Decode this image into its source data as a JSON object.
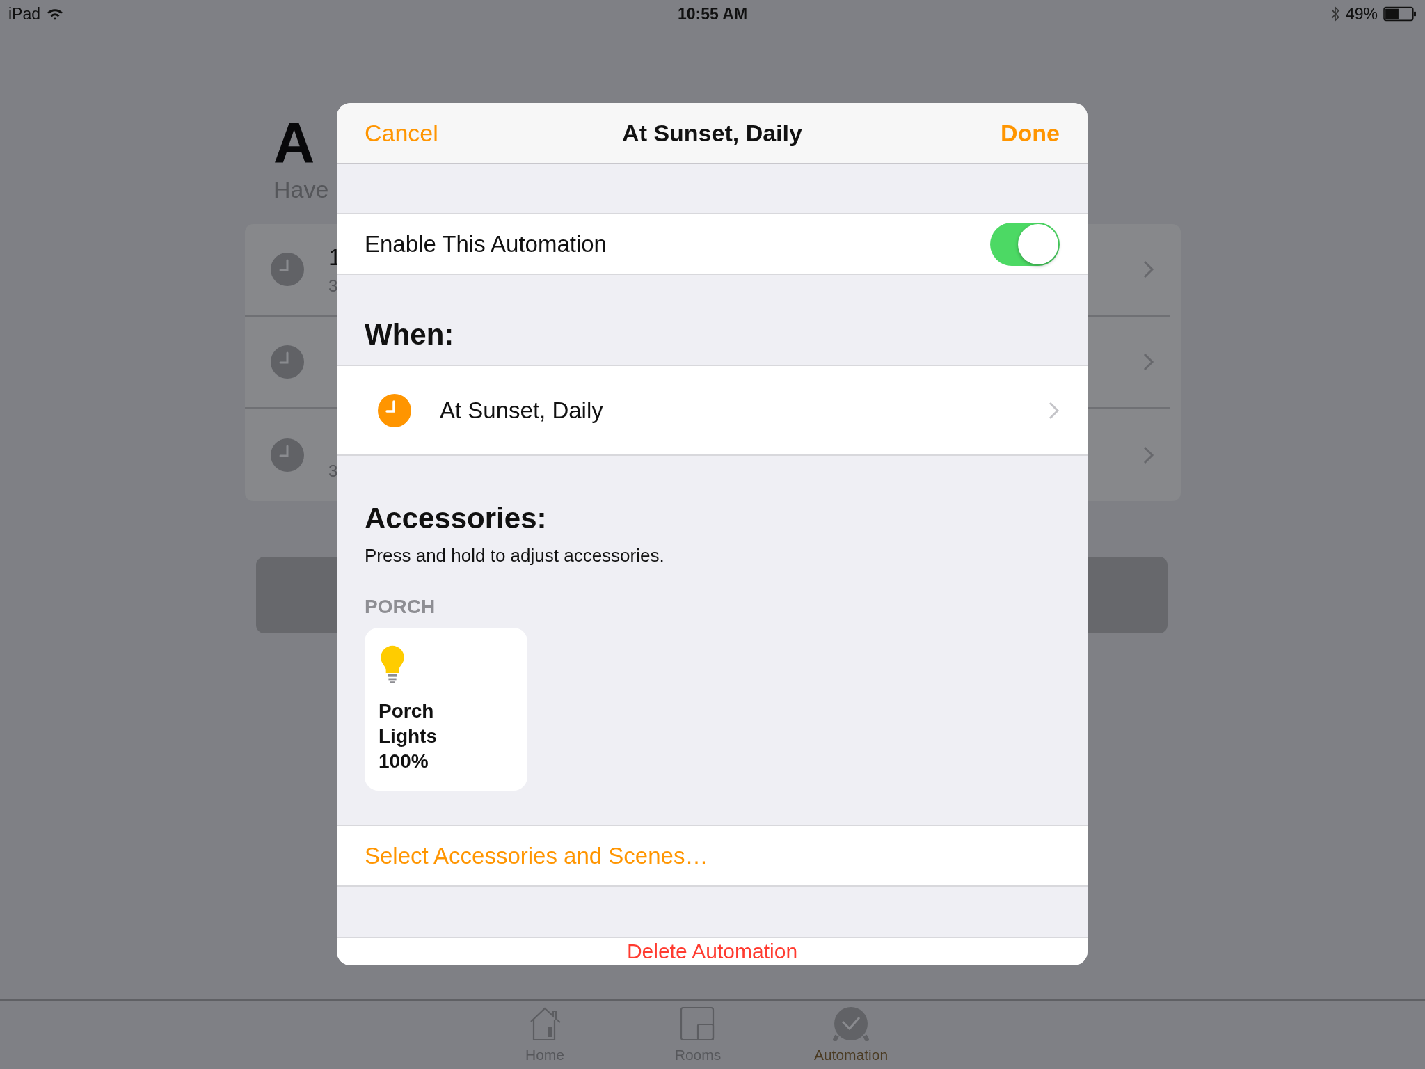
{
  "status_bar": {
    "device": "iPad",
    "time": "10:55 AM",
    "battery": "49%"
  },
  "background": {
    "title": "A",
    "subtitle": "Have",
    "rows": [
      {
        "title": "1",
        "subtitle": "3"
      },
      {},
      {
        "subtitle": "3"
      }
    ]
  },
  "modal": {
    "cancel": "Cancel",
    "title": "At Sunset, Daily",
    "done": "Done",
    "enable": {
      "label": "Enable This Automation",
      "on": true
    },
    "when_heading": "When:",
    "trigger": "At Sunset, Daily",
    "accessories_heading": "Accessories:",
    "accessories_hint": "Press and hold to adjust accessories.",
    "room": "PORCH",
    "accessories": [
      {
        "name": "Porch Lights",
        "value": "100%"
      }
    ],
    "select_link": "Select Accessories and Scenes…",
    "delete": "Delete Automation"
  },
  "tab_bar": [
    {
      "label": "Home",
      "selected": false
    },
    {
      "label": "Rooms",
      "selected": false
    },
    {
      "label": "Automation",
      "selected": true
    }
  ]
}
